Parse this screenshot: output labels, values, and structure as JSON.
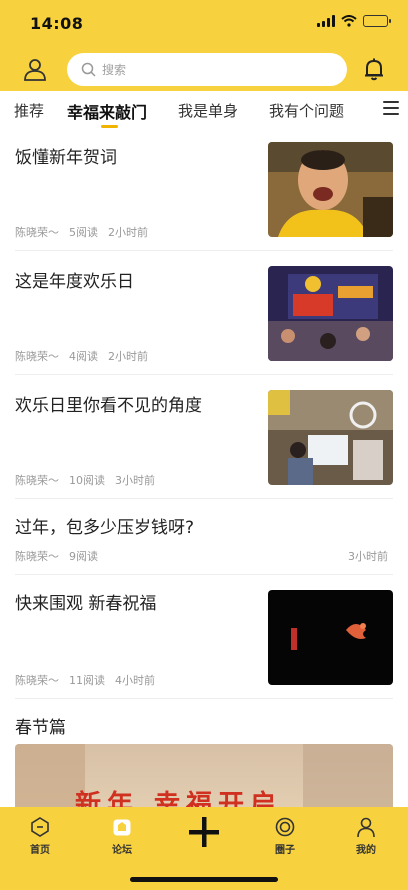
{
  "status_bar": {
    "time": "14:08"
  },
  "search": {
    "placeholder": "搜索"
  },
  "tabs": [
    {
      "label": "推荐"
    },
    {
      "label": "幸福来敲门"
    },
    {
      "label": "我是单身"
    },
    {
      "label": "我有个问题"
    }
  ],
  "articles": [
    {
      "title": "饭懂新年贺词",
      "author": "陈晓荣～",
      "reads": "5阅读",
      "time": "2小时前",
      "thumb_icon": "man-portrait"
    },
    {
      "title": "这是年度欢乐日",
      "author": "陈晓荣～",
      "reads": "4阅读",
      "time": "2小时前",
      "thumb_icon": "stage-event"
    },
    {
      "title": "欢乐日里你看不见的角度",
      "author": "陈晓荣～",
      "reads": "10阅读",
      "time": "3小时前",
      "thumb_icon": "studio-scene"
    },
    {
      "title": "过年，包多少压岁钱呀?",
      "author": "陈晓荣～",
      "reads": "9阅读",
      "time": "3小时前"
    },
    {
      "title": "快来围观 新春祝福",
      "author": "陈晓荣～",
      "reads": "11阅读",
      "time": "4小时前",
      "thumb_icon": "koi-dark"
    }
  ],
  "section": {
    "title": "春节篇",
    "banner_text": "新年 幸福开启"
  },
  "bottom_nav": [
    {
      "label": "首页",
      "icon": "home-icon"
    },
    {
      "label": "论坛",
      "icon": "forum-icon"
    },
    {
      "label": "",
      "icon": "plus-icon"
    },
    {
      "label": "圈子",
      "icon": "circle-icon"
    },
    {
      "label": "我的",
      "icon": "profile-icon"
    }
  ],
  "colors": {
    "brand_yellow": "#f7d23e",
    "tab_underline": "#f0b400"
  }
}
